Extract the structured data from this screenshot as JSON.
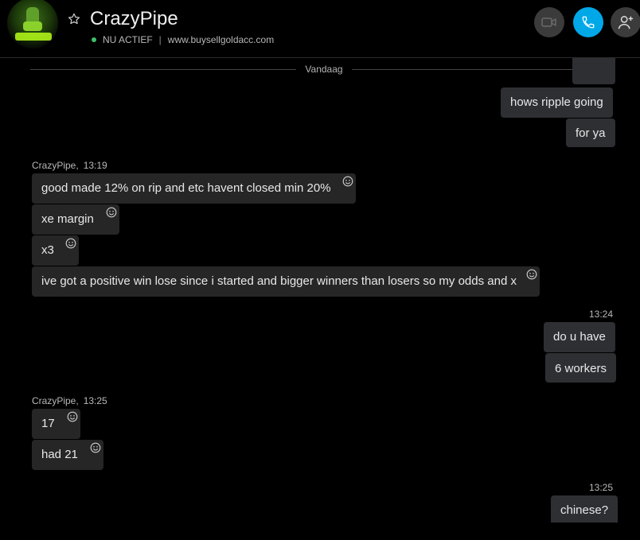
{
  "header": {
    "contact_name": "CrazyPipe",
    "status": "NU ACTIEF",
    "status_separator": "|",
    "mood": "www.buysellgoldacc.com",
    "avatar_icon": "avatar-image",
    "favorite_icon": "star-icon",
    "video_icon": "video-camera-icon",
    "call_icon": "phone-icon",
    "add_icon": "add-person-icon",
    "colors": {
      "call_button": "#00a8e8",
      "online_dot": "#3cc36b"
    }
  },
  "conversation": {
    "date_divider": "Vandaag",
    "messages": [
      {
        "from": "me",
        "text": "hows ripple going"
      },
      {
        "from": "me",
        "text": "for ya"
      },
      {
        "from": "them",
        "sender": "CrazyPipe,",
        "time": "13:19"
      },
      {
        "from": "them",
        "text": "good made 12% on rip and etc havent closed min 20%"
      },
      {
        "from": "them",
        "text": "xe margin"
      },
      {
        "from": "them",
        "text": "x3"
      },
      {
        "from": "them",
        "text": "ive got a positive win lose since i started and bigger winners than losers so my odds and x"
      },
      {
        "from": "me",
        "time": "13:24"
      },
      {
        "from": "me",
        "text": "do u have"
      },
      {
        "from": "me",
        "text": "6 workers"
      },
      {
        "from": "them",
        "sender": "CrazyPipe,",
        "time": "13:25"
      },
      {
        "from": "them",
        "text": "17"
      },
      {
        "from": "them",
        "text": "had 21"
      },
      {
        "from": "me",
        "time": "13:25"
      },
      {
        "from": "me",
        "text": "chinese?"
      }
    ]
  }
}
